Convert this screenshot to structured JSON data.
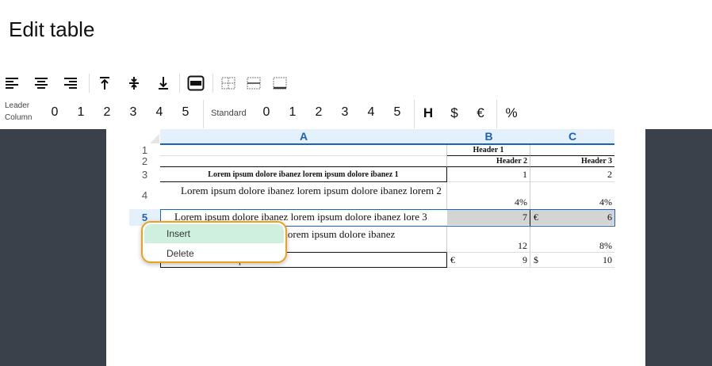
{
  "page": {
    "title": "Edit table"
  },
  "toolbar": {
    "icons": [
      "align-left-icon",
      "align-center-icon",
      "align-right-icon",
      "valign-top-icon",
      "valign-middle-icon",
      "valign-bottom-icon",
      "header-row-icon",
      "grid-borders-icon",
      "inner-borders-icon",
      "bottom-border-icon"
    ]
  },
  "numbering": {
    "leader_label_1": "Leader",
    "leader_label_2": "Column",
    "leader_values": [
      "0",
      "1",
      "2",
      "3",
      "4",
      "5"
    ],
    "standard_label": "Standard",
    "standard_values": [
      "0",
      "1",
      "2",
      "3",
      "4",
      "5"
    ],
    "symbols": [
      "H",
      "$",
      "€",
      "%"
    ]
  },
  "table": {
    "columns": [
      "A",
      "B",
      "C"
    ],
    "rows": [
      "1",
      "2",
      "3",
      "4",
      "5"
    ],
    "header1": "Header 1",
    "header2": "Header 2",
    "header3": "Header 3",
    "r3_a": "Lorem ipsum dolore ibanez lorem ipsum dolore ibanez 1",
    "r3_b": "1",
    "r3_c": "2",
    "r4_a": "Lorem ipsum dolore ibanez lorem ipsum dolore ibanez lorem 2",
    "r4_b": "4%",
    "r4_c": "4%",
    "r5_a": "Lorem ipsum dolore ibanez lorem ipsum dolore ibanez lore 3",
    "r5_b": "7",
    "r5_c_cur": "€",
    "r5_c": "6",
    "r6_a": "nez lorem ipsum dolore ibanez",
    "r6_b": "12",
    "r6_c": "8%",
    "r7_a": "p",
    "r7_b_cur": "€",
    "r7_b": "9",
    "r7_c_cur": "$",
    "r7_c": "10"
  },
  "context_menu": {
    "insert": "Insert",
    "delete": "Delete"
  },
  "colors": {
    "accent": "#1a63b8",
    "menu_border": "#f0a020",
    "menu_active": "#cfefdf",
    "side_panels": "#3a414b"
  }
}
